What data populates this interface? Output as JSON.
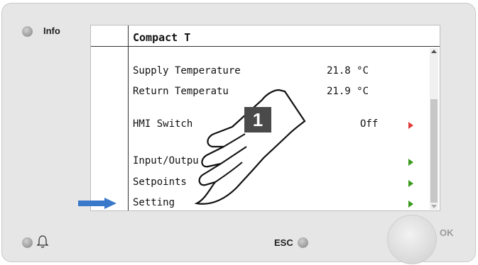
{
  "panel": {
    "info_label": "Info",
    "esc_label": "ESC",
    "ok_label": "OK"
  },
  "screen": {
    "title": "Compact T",
    "rows": [
      {
        "name": "Supply Temperature",
        "value": "21.8 °C"
      },
      {
        "name": "Return Temperatu",
        "value": "21.9 °C"
      },
      {
        "name": "HMI Switch",
        "value": "Off"
      },
      {
        "name": "Input/Outpu",
        "value": ""
      },
      {
        "name": "Setpoints",
        "value": ""
      },
      {
        "name": "Setting",
        "value": ""
      }
    ]
  },
  "callout": {
    "number": "1"
  },
  "colors": {
    "green_arrow": "#3a9a1e",
    "red_arrow": "#e23b3b",
    "blue_pointer": "#3a78c9"
  }
}
